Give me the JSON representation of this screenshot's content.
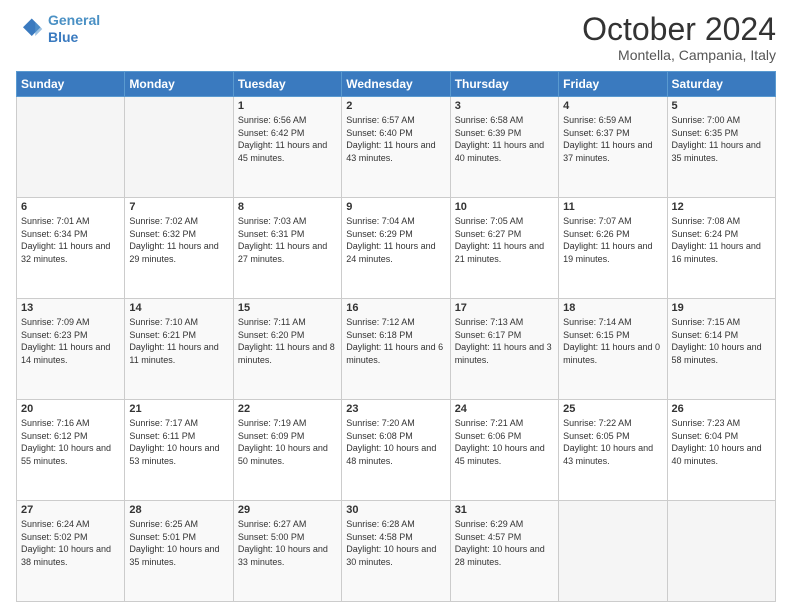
{
  "header": {
    "logo_line1": "General",
    "logo_line2": "Blue",
    "month_title": "October 2024",
    "location": "Montella, Campania, Italy"
  },
  "days_of_week": [
    "Sunday",
    "Monday",
    "Tuesday",
    "Wednesday",
    "Thursday",
    "Friday",
    "Saturday"
  ],
  "weeks": [
    [
      {
        "day": "",
        "info": ""
      },
      {
        "day": "",
        "info": ""
      },
      {
        "day": "1",
        "info": "Sunrise: 6:56 AM\nSunset: 6:42 PM\nDaylight: 11 hours and 45 minutes."
      },
      {
        "day": "2",
        "info": "Sunrise: 6:57 AM\nSunset: 6:40 PM\nDaylight: 11 hours and 43 minutes."
      },
      {
        "day": "3",
        "info": "Sunrise: 6:58 AM\nSunset: 6:39 PM\nDaylight: 11 hours and 40 minutes."
      },
      {
        "day": "4",
        "info": "Sunrise: 6:59 AM\nSunset: 6:37 PM\nDaylight: 11 hours and 37 minutes."
      },
      {
        "day": "5",
        "info": "Sunrise: 7:00 AM\nSunset: 6:35 PM\nDaylight: 11 hours and 35 minutes."
      }
    ],
    [
      {
        "day": "6",
        "info": "Sunrise: 7:01 AM\nSunset: 6:34 PM\nDaylight: 11 hours and 32 minutes."
      },
      {
        "day": "7",
        "info": "Sunrise: 7:02 AM\nSunset: 6:32 PM\nDaylight: 11 hours and 29 minutes."
      },
      {
        "day": "8",
        "info": "Sunrise: 7:03 AM\nSunset: 6:31 PM\nDaylight: 11 hours and 27 minutes."
      },
      {
        "day": "9",
        "info": "Sunrise: 7:04 AM\nSunset: 6:29 PM\nDaylight: 11 hours and 24 minutes."
      },
      {
        "day": "10",
        "info": "Sunrise: 7:05 AM\nSunset: 6:27 PM\nDaylight: 11 hours and 21 minutes."
      },
      {
        "day": "11",
        "info": "Sunrise: 7:07 AM\nSunset: 6:26 PM\nDaylight: 11 hours and 19 minutes."
      },
      {
        "day": "12",
        "info": "Sunrise: 7:08 AM\nSunset: 6:24 PM\nDaylight: 11 hours and 16 minutes."
      }
    ],
    [
      {
        "day": "13",
        "info": "Sunrise: 7:09 AM\nSunset: 6:23 PM\nDaylight: 11 hours and 14 minutes."
      },
      {
        "day": "14",
        "info": "Sunrise: 7:10 AM\nSunset: 6:21 PM\nDaylight: 11 hours and 11 minutes."
      },
      {
        "day": "15",
        "info": "Sunrise: 7:11 AM\nSunset: 6:20 PM\nDaylight: 11 hours and 8 minutes."
      },
      {
        "day": "16",
        "info": "Sunrise: 7:12 AM\nSunset: 6:18 PM\nDaylight: 11 hours and 6 minutes."
      },
      {
        "day": "17",
        "info": "Sunrise: 7:13 AM\nSunset: 6:17 PM\nDaylight: 11 hours and 3 minutes."
      },
      {
        "day": "18",
        "info": "Sunrise: 7:14 AM\nSunset: 6:15 PM\nDaylight: 11 hours and 0 minutes."
      },
      {
        "day": "19",
        "info": "Sunrise: 7:15 AM\nSunset: 6:14 PM\nDaylight: 10 hours and 58 minutes."
      }
    ],
    [
      {
        "day": "20",
        "info": "Sunrise: 7:16 AM\nSunset: 6:12 PM\nDaylight: 10 hours and 55 minutes."
      },
      {
        "day": "21",
        "info": "Sunrise: 7:17 AM\nSunset: 6:11 PM\nDaylight: 10 hours and 53 minutes."
      },
      {
        "day": "22",
        "info": "Sunrise: 7:19 AM\nSunset: 6:09 PM\nDaylight: 10 hours and 50 minutes."
      },
      {
        "day": "23",
        "info": "Sunrise: 7:20 AM\nSunset: 6:08 PM\nDaylight: 10 hours and 48 minutes."
      },
      {
        "day": "24",
        "info": "Sunrise: 7:21 AM\nSunset: 6:06 PM\nDaylight: 10 hours and 45 minutes."
      },
      {
        "day": "25",
        "info": "Sunrise: 7:22 AM\nSunset: 6:05 PM\nDaylight: 10 hours and 43 minutes."
      },
      {
        "day": "26",
        "info": "Sunrise: 7:23 AM\nSunset: 6:04 PM\nDaylight: 10 hours and 40 minutes."
      }
    ],
    [
      {
        "day": "27",
        "info": "Sunrise: 6:24 AM\nSunset: 5:02 PM\nDaylight: 10 hours and 38 minutes."
      },
      {
        "day": "28",
        "info": "Sunrise: 6:25 AM\nSunset: 5:01 PM\nDaylight: 10 hours and 35 minutes."
      },
      {
        "day": "29",
        "info": "Sunrise: 6:27 AM\nSunset: 5:00 PM\nDaylight: 10 hours and 33 minutes."
      },
      {
        "day": "30",
        "info": "Sunrise: 6:28 AM\nSunset: 4:58 PM\nDaylight: 10 hours and 30 minutes."
      },
      {
        "day": "31",
        "info": "Sunrise: 6:29 AM\nSunset: 4:57 PM\nDaylight: 10 hours and 28 minutes."
      },
      {
        "day": "",
        "info": ""
      },
      {
        "day": "",
        "info": ""
      }
    ]
  ]
}
